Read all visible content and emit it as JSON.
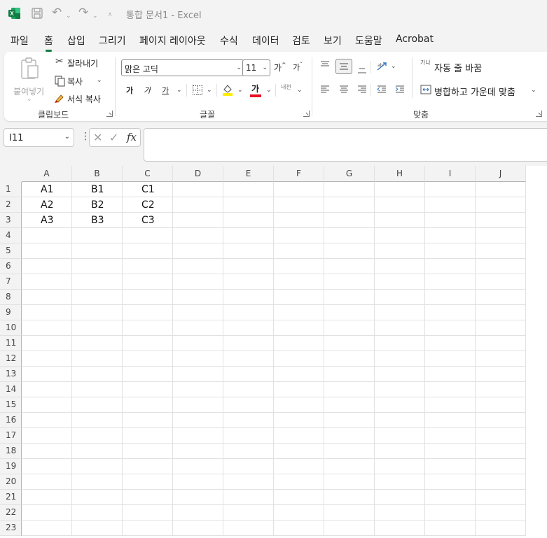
{
  "titlebar": {
    "app_icon": "excel-logo-icon",
    "save_icon": "save-icon",
    "undo_icon": "undo-icon",
    "redo_icon": "redo-icon",
    "customize_icon": "customize-quick-access-icon",
    "title": "통합 문서1  -  Excel"
  },
  "tabs": [
    "파일",
    "홈",
    "삽입",
    "그리기",
    "페이지 레이아웃",
    "수식",
    "데이터",
    "검토",
    "보기",
    "도움말",
    "Acrobat"
  ],
  "active_tab": "홈",
  "colors": {
    "accent": "#107c41",
    "font_color_bar": "#e81123",
    "highlight_bar": "#ffee00"
  },
  "ribbon": {
    "clipboard": {
      "label": "클립보드",
      "paste": "붙여넣기",
      "cut": "잘라내기",
      "copy": "복사",
      "format_painter": "서식 복사"
    },
    "font": {
      "label": "글꼴",
      "font_name": "맑은 고딕",
      "font_size": "11",
      "grow": "가",
      "shrink": "가",
      "bold": "가",
      "italic": "가",
      "underline": "가",
      "font_color": "가",
      "phonetic": "내천"
    },
    "alignment": {
      "label": "맞춤",
      "wrap_text": "자동 줄 바꿈",
      "merge_center": "병합하고 가운데 맞춤",
      "wrap_icon_text": "가나"
    }
  },
  "formula_bar": {
    "name_box": "I11",
    "cancel": "✕",
    "enter": "✓",
    "fx": "fx",
    "value": ""
  },
  "grid": {
    "columns": [
      "A",
      "B",
      "C",
      "D",
      "E",
      "F",
      "G",
      "H",
      "I",
      "J"
    ],
    "rows": [
      "1",
      "2",
      "3",
      "4",
      "5",
      "6",
      "7",
      "8",
      "9",
      "10",
      "11",
      "12",
      "13",
      "14",
      "15",
      "16",
      "17",
      "18",
      "19",
      "20",
      "21",
      "22",
      "23"
    ],
    "cells": [
      [
        "A1",
        "B1",
        "C1"
      ],
      [
        "A2",
        "B2",
        "C2"
      ],
      [
        "A3",
        "B3",
        "C3"
      ]
    ]
  }
}
